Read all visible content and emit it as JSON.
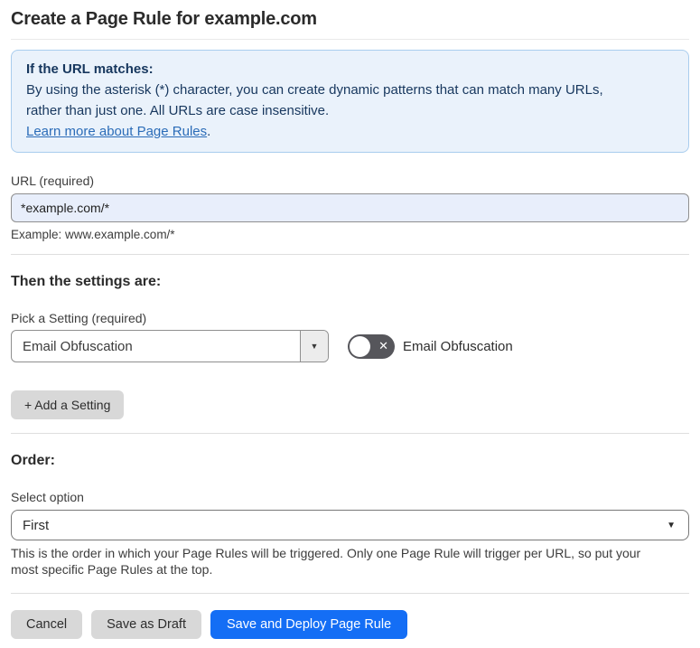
{
  "page": {
    "title": "Create a Page Rule for example.com"
  },
  "info_box": {
    "heading": "If the URL matches:",
    "body_line1": "By using the asterisk (*) character, you can create dynamic patterns that can match many URLs,",
    "body_line2": "rather than just one. All URLs are case insensitive.",
    "link_label": "Learn more about Page Rules",
    "link_suffix": "."
  },
  "url_field": {
    "label": "URL (required)",
    "value": "*example.com/*",
    "example": "Example: www.example.com/*"
  },
  "settings_section": {
    "heading": "Then the settings are:",
    "picker_label": "Pick a Setting (required)",
    "picker_value": "Email Obfuscation",
    "toggle_label": "Email Obfuscation",
    "toggle_state": "off",
    "add_button_label": "+ Add a Setting"
  },
  "order_section": {
    "heading": "Order:",
    "select_label": "Select option",
    "select_value": "First",
    "help_line1": "This is the order in which your Page Rules will be triggered. Only one Page Rule will trigger per URL, so put your",
    "help_line2": "most specific Page Rules at the top."
  },
  "footer": {
    "cancel_label": "Cancel",
    "save_draft_label": "Save as Draft",
    "save_deploy_label": "Save and Deploy Page Rule"
  },
  "icons": {
    "dropdown_arrow": "▼",
    "toggle_off_x": "✕"
  },
  "colors": {
    "info_bg": "#eaf2fb",
    "info_border": "#a9cdee",
    "info_text": "#17375e",
    "link": "#2b6cb8",
    "url_input_bg": "#e8eefb",
    "primary_button": "#146ef5",
    "gray_button": "#d8d8d8",
    "toggle_off_bg": "#56565b"
  }
}
